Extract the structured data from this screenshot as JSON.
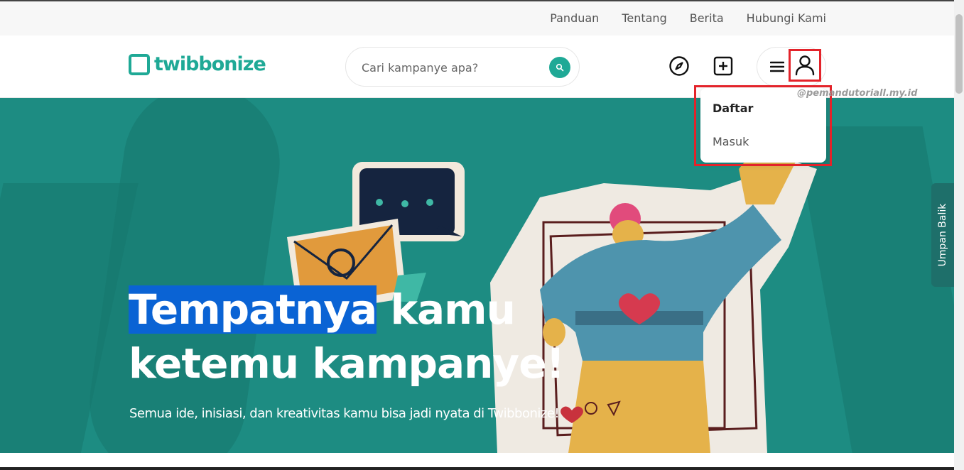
{
  "top_nav": {
    "links": [
      "Panduan",
      "Tentang",
      "Berita",
      "Hubungi Kami"
    ]
  },
  "header": {
    "logo_text": "twibbonize",
    "search_placeholder": "Cari kampanye apa?"
  },
  "user_menu": {
    "items": [
      "Daftar",
      "Masuk"
    ]
  },
  "watermark": "@pemandutoriall.my.id",
  "hero": {
    "title_highlight": "Tempatnya",
    "title_rest_line1": " kamu",
    "title_line2": "ketemu kampanye!",
    "subtitle": "Semua ide, inisiasi, dan kreativitas kamu bisa jadi nyata di Twibbonize!"
  },
  "feedback_tab": "Umpan Balik",
  "colors": {
    "brand": "#1fa996",
    "hero_bg": "#1d8c82",
    "highlight": "#e3232a"
  }
}
